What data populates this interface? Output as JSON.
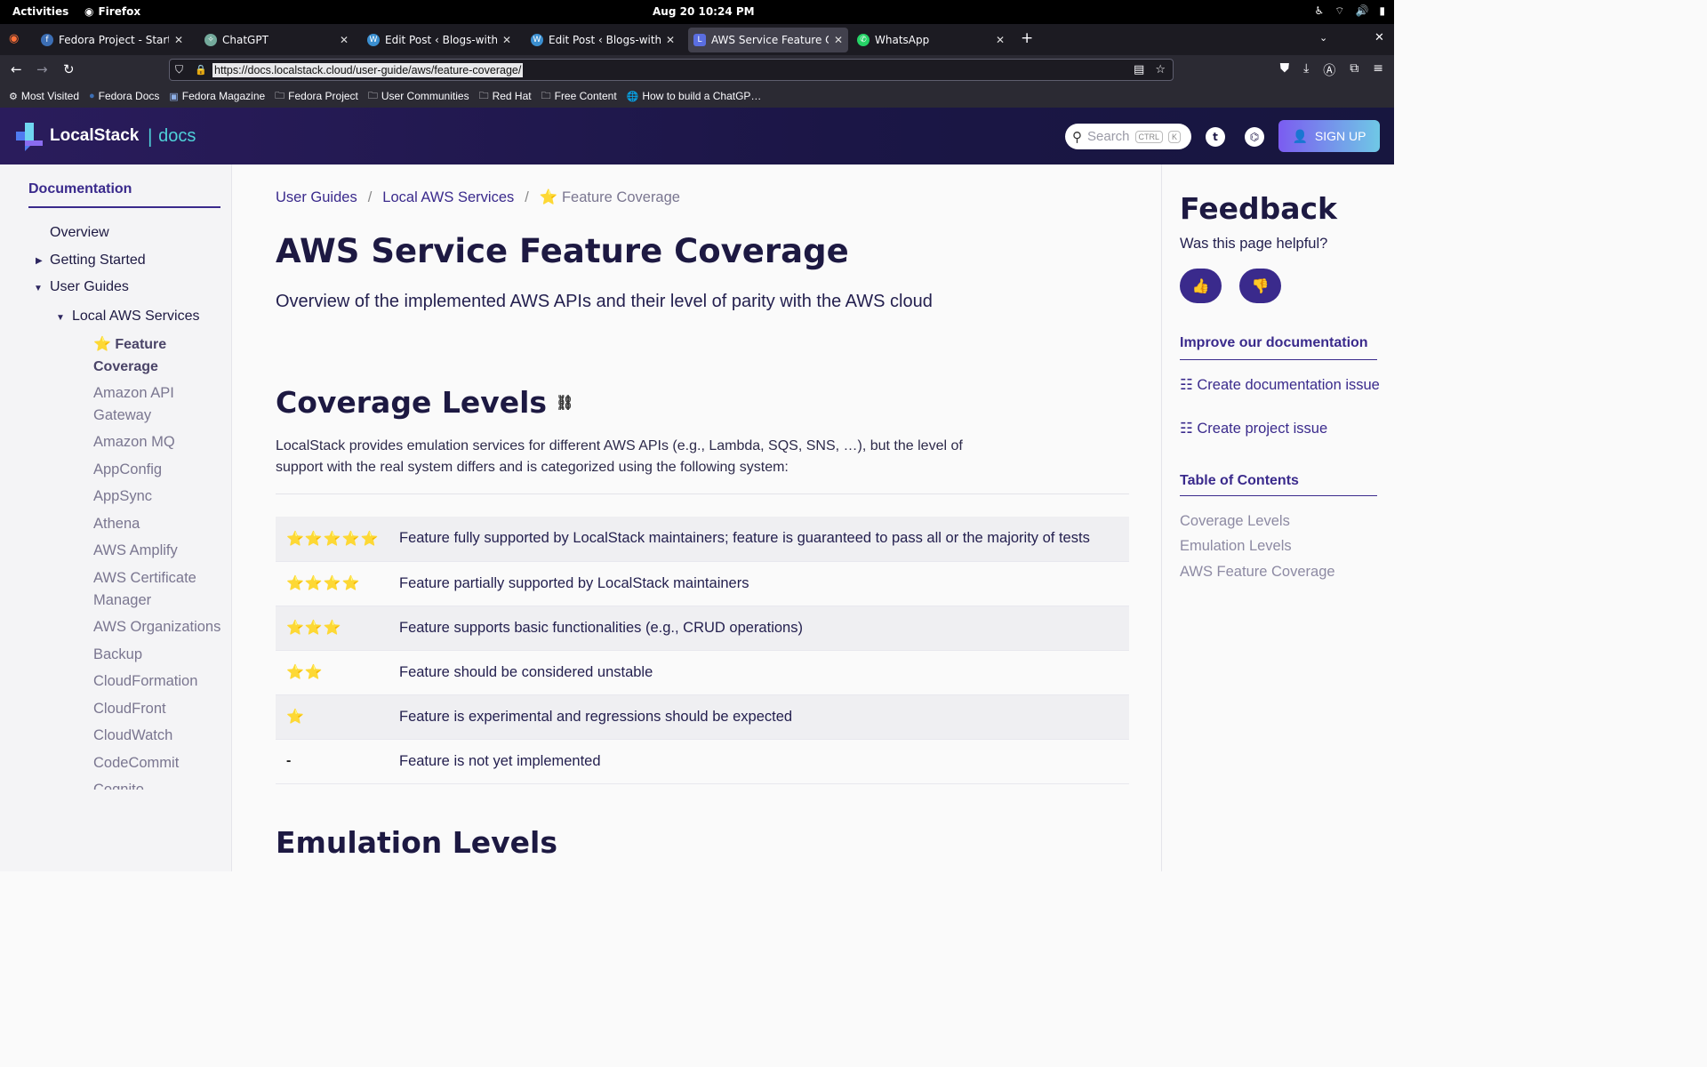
{
  "system": {
    "activities": "Activities",
    "app_name": "Firefox",
    "clock": "Aug 20  10:24 PM"
  },
  "browser": {
    "tabs": [
      {
        "title": "Fedora Project - Start Pag",
        "favicon": "fedora-icon",
        "active": false
      },
      {
        "title": "ChatGPT",
        "favicon": "chatgpt-icon",
        "active": false
      },
      {
        "title": "Edit Post ‹ Blogs-with-Ac",
        "favicon": "wordpress-icon",
        "active": false
      },
      {
        "title": "Edit Post ‹ Blogs-with-Ac",
        "favicon": "wordpress-icon",
        "active": false
      },
      {
        "title": "AWS Service Feature Cove",
        "favicon": "localstack-icon",
        "active": true
      },
      {
        "title": "WhatsApp",
        "favicon": "whatsapp-icon",
        "active": false
      }
    ],
    "url": "https://docs.localstack.cloud/user-guide/aws/feature-coverage/",
    "bookmarks": [
      {
        "label": "Most Visited",
        "icon": "gear-icon"
      },
      {
        "label": "Fedora Docs",
        "icon": "fedora-icon"
      },
      {
        "label": "Fedora Magazine",
        "icon": "fm-icon"
      },
      {
        "label": "Fedora Project",
        "icon": "folder-icon"
      },
      {
        "label": "User Communities",
        "icon": "folder-icon"
      },
      {
        "label": "Red Hat",
        "icon": "folder-icon"
      },
      {
        "label": "Free Content",
        "icon": "folder-icon"
      },
      {
        "label": "How to build a ChatGP…",
        "icon": "globe-icon"
      }
    ]
  },
  "header": {
    "brand": "LocalStack",
    "docs": "docs",
    "search_placeholder": "Search",
    "kbd_ctrl": "CTRL",
    "kbd_k": "K",
    "signup": "SIGN UP"
  },
  "sidebar": {
    "title": "Documentation",
    "items": [
      {
        "label": "Overview"
      },
      {
        "label": "Getting Started"
      },
      {
        "label": "User Guides"
      },
      {
        "label": "Local AWS Services"
      },
      {
        "label": "⭐ Feature Coverage"
      },
      {
        "label": "Amazon API Gateway"
      },
      {
        "label": "Amazon MQ"
      },
      {
        "label": "AppConfig"
      },
      {
        "label": "AppSync"
      },
      {
        "label": "Athena"
      },
      {
        "label": "AWS Amplify"
      },
      {
        "label": "AWS Certificate Manager"
      },
      {
        "label": "AWS Organizations"
      },
      {
        "label": "Backup"
      },
      {
        "label": "CloudFormation"
      },
      {
        "label": "CloudFront"
      },
      {
        "label": "CloudWatch"
      },
      {
        "label": "CodeCommit"
      },
      {
        "label": "Cognito"
      }
    ]
  },
  "main": {
    "breadcrumbs": [
      "User Guides",
      "Local AWS Services",
      "⭐ Feature Coverage"
    ],
    "title": "AWS Service Feature Coverage",
    "lead": "Overview of the implemented AWS APIs and their level of parity with the AWS cloud",
    "coverage_heading": "Coverage Levels",
    "coverage_intro": "LocalStack provides emulation services for different AWS APIs (e.g., Lambda, SQS, SNS, …), but the level of support with the real system differs and is categorized using the following system:",
    "levels": [
      {
        "stars": "⭐⭐⭐⭐⭐",
        "description": "Feature fully supported by LocalStack maintainers; feature is guaranteed to pass all or the majority of tests"
      },
      {
        "stars": "⭐⭐⭐⭐",
        "description": "Feature partially supported by LocalStack maintainers"
      },
      {
        "stars": "⭐⭐⭐",
        "description": "Feature supports basic functionalities (e.g., CRUD operations)"
      },
      {
        "stars": "⭐⭐",
        "description": "Feature should be considered unstable"
      },
      {
        "stars": "⭐",
        "description": "Feature is experimental and regressions should be expected"
      },
      {
        "stars": "-",
        "description": "Feature is not yet implemented"
      }
    ],
    "emulation_heading": "Emulation Levels"
  },
  "right_panel": {
    "feedback_title": "Feedback",
    "feedback_question": "Was this page helpful?",
    "improve_heading": "Improve our documentation",
    "create_doc_issue": "Create documentation issue",
    "create_project_issue": "Create project issue",
    "toc_heading": "Table of Contents",
    "toc": [
      "Coverage Levels",
      "Emulation Levels",
      "AWS Feature Coverage"
    ]
  },
  "colors": {
    "brand_purple": "#3a2a8c",
    "header_bg": "#1b1646",
    "accent_cyan": "#4fd1d9",
    "star": "#f5c518"
  }
}
